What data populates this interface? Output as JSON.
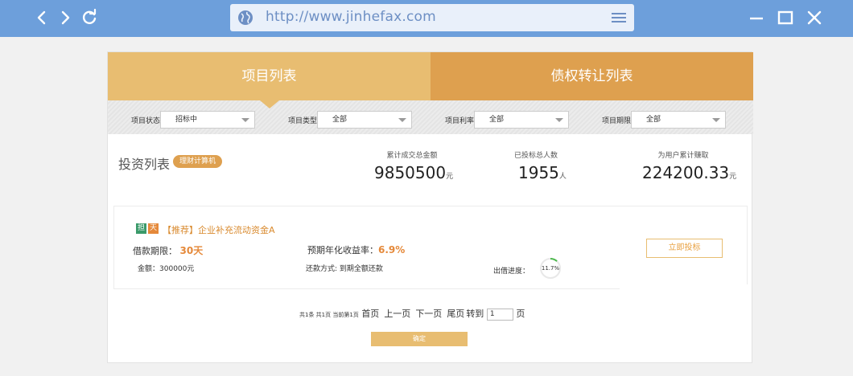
{
  "browser": {
    "url": "http://www.jinhefax.com",
    "icons": [
      "back-icon",
      "forward-icon",
      "refresh-icon",
      "globe-icon",
      "menu-icon",
      "minimize-icon",
      "maximize-icon",
      "close-icon"
    ]
  },
  "tabs": [
    {
      "label": "项目列表",
      "active": true
    },
    {
      "label": "债权转让列表",
      "active": false
    }
  ],
  "filters": [
    {
      "label": "项目状态",
      "value": "招标中"
    },
    {
      "label": "项目类型",
      "value": "全部"
    },
    {
      "label": "项目利率",
      "value": "全部"
    },
    {
      "label": "项目期限",
      "value": "全部"
    }
  ],
  "summary": {
    "title": "投资列表",
    "calc_button": "理财计算机",
    "stats": [
      {
        "label": "累计成交总金额",
        "value": "9850500",
        "unit": "元"
      },
      {
        "label": "已投标总人数",
        "value": "1955",
        "unit": "人"
      },
      {
        "label": "为用户累计赚取",
        "value": "224200.33",
        "unit": "元"
      }
    ]
  },
  "project": {
    "badges": [
      "担",
      "天"
    ],
    "name": "【推荐】企业补充流动资金A",
    "term_label": "借款期限：",
    "term_value": "30天",
    "rate_label": "预期年化收益率：",
    "rate_value": "6.9%",
    "amount_label": "金额：",
    "amount_value": "300000元",
    "repay_label": "还款方式:",
    "repay_value": "到期全额还款",
    "progress_label": "出借进度：",
    "progress_text": "11.7%",
    "progress": 0.117,
    "invest_button": "立即投标"
  },
  "pagination": {
    "summary": "共1条 共1页 当前第1页",
    "first": "首页",
    "prev": "上一页",
    "next": "下一页",
    "last": "尾页",
    "goto": "转到",
    "page_value": "1",
    "page_unit": "页",
    "confirm": "确定"
  },
  "colors": {
    "chrome": "#6d9fdb",
    "tab_active": "#e8bd71",
    "tab_inactive": "#dea04f",
    "accent_orange": "#e5893a",
    "badge_green": "#3a9a6a",
    "progress_green": "#4cb84c"
  }
}
